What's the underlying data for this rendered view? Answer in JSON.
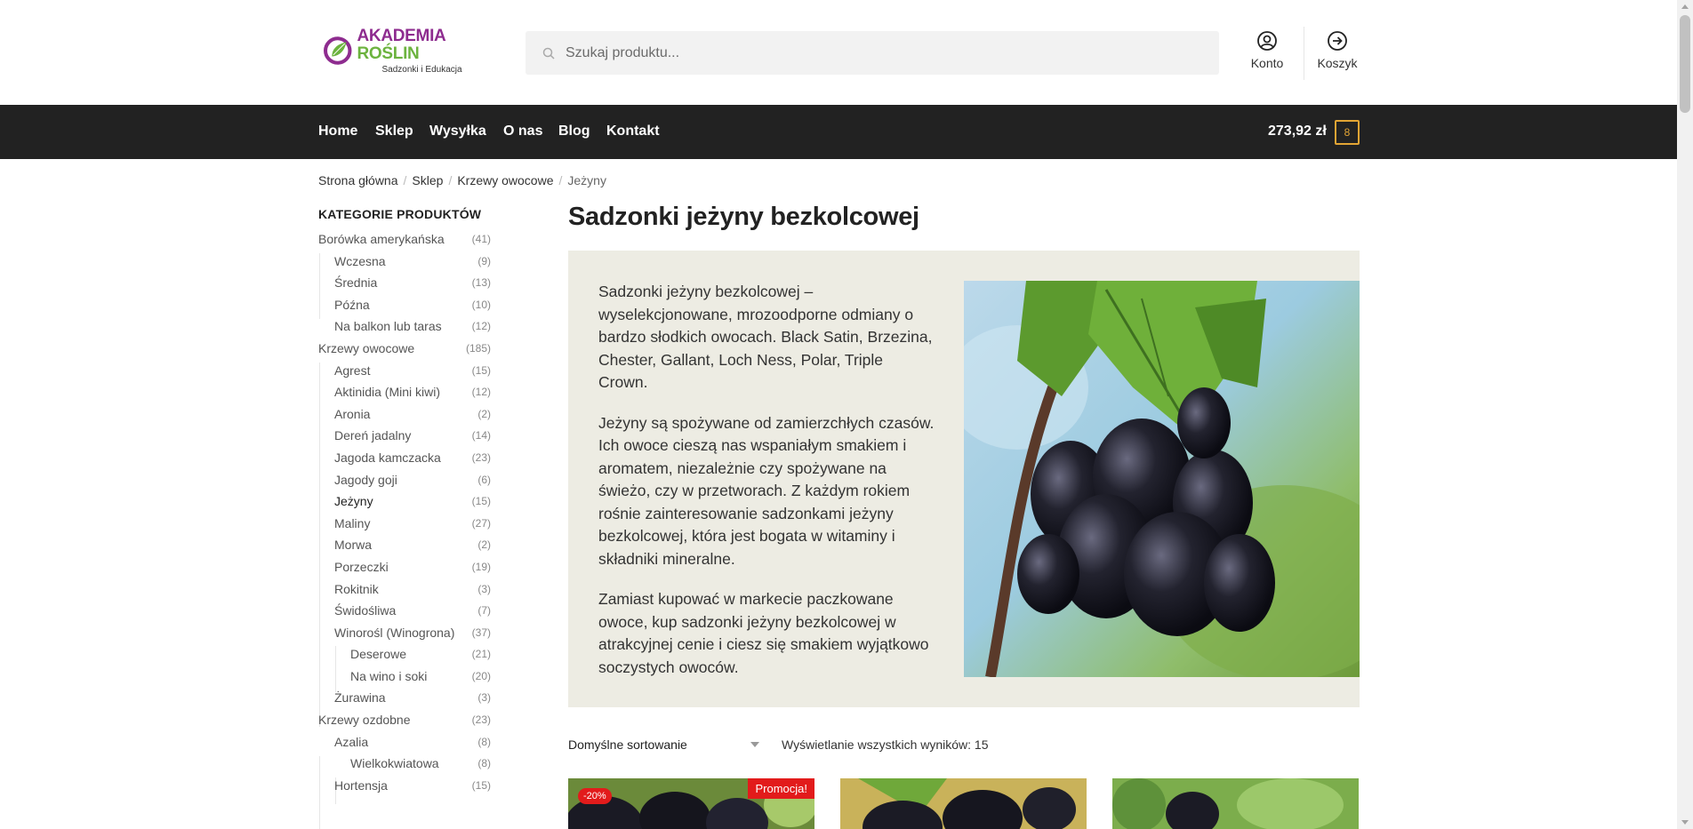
{
  "brand": {
    "name_part1": "AKADEMIA ",
    "name_part2": "ROŚLIN",
    "tagline": "Sadzonki i Edukacja",
    "colors": {
      "purple": "#8e2c8f",
      "green": "#6cb33f"
    }
  },
  "search": {
    "placeholder": "Szukaj produktu...",
    "icon": "search-icon"
  },
  "header_links": {
    "account": {
      "label": "Konto",
      "icon": "user-circle-icon"
    },
    "cart": {
      "label": "Koszyk",
      "icon": "arrow-circle-right-icon"
    }
  },
  "nav": {
    "items": [
      "Home",
      "Sklep",
      "Wysyłka",
      "O nas",
      "Blog",
      "Kontakt"
    ],
    "cart_total": "273,92 zł",
    "cart_count": "8",
    "colors": {
      "background": "#222222",
      "accent": "#e3a534"
    }
  },
  "breadcrumb": [
    "Strona główna",
    "Sklep",
    "Krzewy owocowe",
    "Jeżyny"
  ],
  "sidebar": {
    "heading": "KATEGORIE PRODUKTÓW",
    "categories": [
      {
        "label": "Borówka amerykańska",
        "count": "(41)",
        "level": 1
      },
      {
        "label": "Wczesna",
        "count": "(9)",
        "level": 2
      },
      {
        "label": "Średnia",
        "count": "(13)",
        "level": 2
      },
      {
        "label": "Późna",
        "count": "(10)",
        "level": 2
      },
      {
        "label": "Na balkon lub taras",
        "count": "(12)",
        "level": 2
      },
      {
        "label": "Krzewy owocowe",
        "count": "(185)",
        "level": 1
      },
      {
        "label": "Agrest",
        "count": "(15)",
        "level": 2
      },
      {
        "label": "Aktinidia (Mini kiwi)",
        "count": "(12)",
        "level": 2
      },
      {
        "label": "Aronia",
        "count": "(2)",
        "level": 2
      },
      {
        "label": "Dereń jadalny",
        "count": "(14)",
        "level": 2
      },
      {
        "label": "Jagoda kamczacka",
        "count": "(23)",
        "level": 2
      },
      {
        "label": "Jagody goji",
        "count": "(6)",
        "level": 2
      },
      {
        "label": "Jeżyny",
        "count": "(15)",
        "level": 2,
        "active": true
      },
      {
        "label": "Maliny",
        "count": "(27)",
        "level": 2
      },
      {
        "label": "Morwa",
        "count": "(2)",
        "level": 2
      },
      {
        "label": "Porzeczki",
        "count": "(19)",
        "level": 2
      },
      {
        "label": "Rokitnik",
        "count": "(3)",
        "level": 2
      },
      {
        "label": "Świdośliwa",
        "count": "(7)",
        "level": 2
      },
      {
        "label": "Winorośl (Winogrona)",
        "count": "(37)",
        "level": 2
      },
      {
        "label": "Deserowe",
        "count": "(21)",
        "level": 3
      },
      {
        "label": "Na wino i soki",
        "count": "(20)",
        "level": 3
      },
      {
        "label": "Żurawina",
        "count": "(3)",
        "level": 2
      },
      {
        "label": "Krzewy ozdobne",
        "count": "(23)",
        "level": 1
      },
      {
        "label": "Azalia",
        "count": "(8)",
        "level": 2
      },
      {
        "label": "Wielkokwiatowa",
        "count": "(8)",
        "level": 3
      },
      {
        "label": "Hortensja",
        "count": "(15)",
        "level": 2
      }
    ]
  },
  "main": {
    "title": "Sadzonki jeżyny bezkolcowej",
    "description": [
      "Sadzonki jeżyny bezkolcowej – wyselekcjonowane, mrozoodporne odmiany o bardzo słodkich owocach. Black Satin, Brzezina, Chester, Gallant, Loch Ness, Polar, Triple Crown.",
      "Jeżyny są spożywane od zamierzchłych czasów. Ich owoce cieszą nas wspaniałym smakiem i aromatem, niezależnie czy spożywane na świeżo, czy w przetworach. Z każdym rokiem rośnie zainteresowanie sadzonkami jeżyny bezkolcowej, która jest bogata w witaminy i składniki mineralne.",
      "Zamiast kupować w markecie paczkowane owoce, kup sadzonki jeżyny bezkolcowej w atrakcyjnej cenie i ciesz się smakiem wyjątkowo soczystych owoców."
    ],
    "image_subject": "blackberries-on-branch",
    "sort_label": "Domyślne sortowanie",
    "result_count": "Wyświetlanie wszystkich wyników: 15",
    "products": [
      {
        "sale_badge": "Promocja!",
        "discount": "-20%"
      },
      {
        "sale_badge": "",
        "discount": ""
      },
      {
        "sale_badge": "",
        "discount": ""
      }
    ]
  }
}
